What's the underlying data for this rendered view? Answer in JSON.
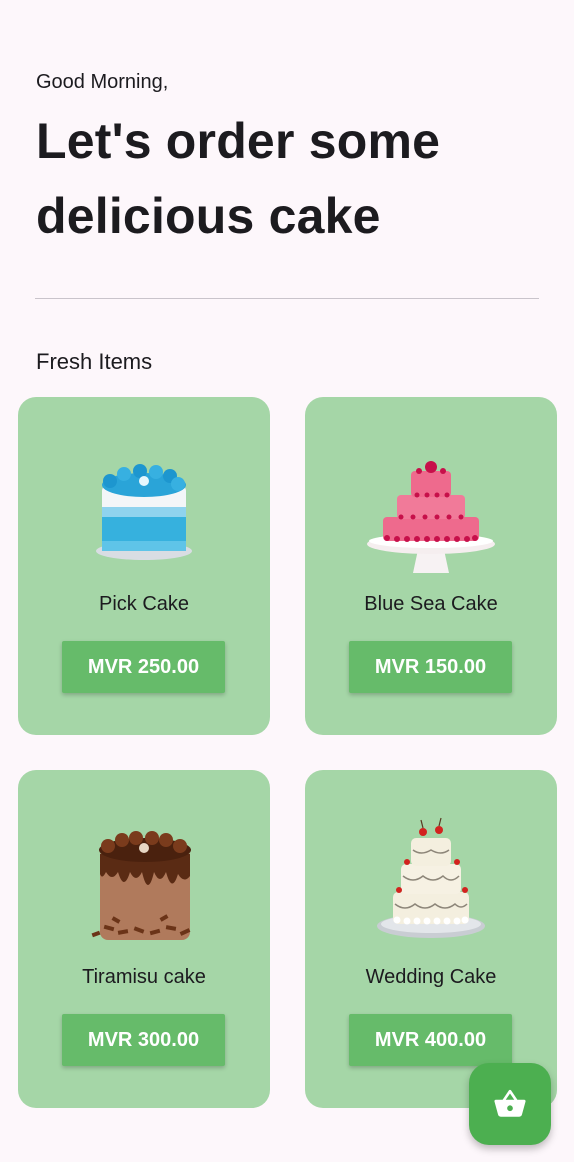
{
  "header": {
    "greeting": "Good Morning,",
    "headline": "Let's order some delicious cake"
  },
  "section": {
    "title": "Fresh Items"
  },
  "items": [
    {
      "name": "Pick Cake",
      "price": "MVR 250.00",
      "image_icon": "blue-frosted-cake-image"
    },
    {
      "name": "Blue Sea Cake",
      "price": "MVR 150.00",
      "image_icon": "pink-tiered-cake-image"
    },
    {
      "name": "Tiramisu cake",
      "price": "MVR 300.00",
      "image_icon": "chocolate-cake-image"
    },
    {
      "name": "Wedding Cake",
      "price": "MVR 400.00",
      "image_icon": "wedding-cake-image"
    }
  ],
  "fab": {
    "icon": "shopping-basket-icon"
  },
  "colors": {
    "background": "#fdf7fb",
    "card": "#a5d6a7",
    "button": "#66bb6a",
    "fab": "#4caf50",
    "text": "#1c1b1f"
  }
}
